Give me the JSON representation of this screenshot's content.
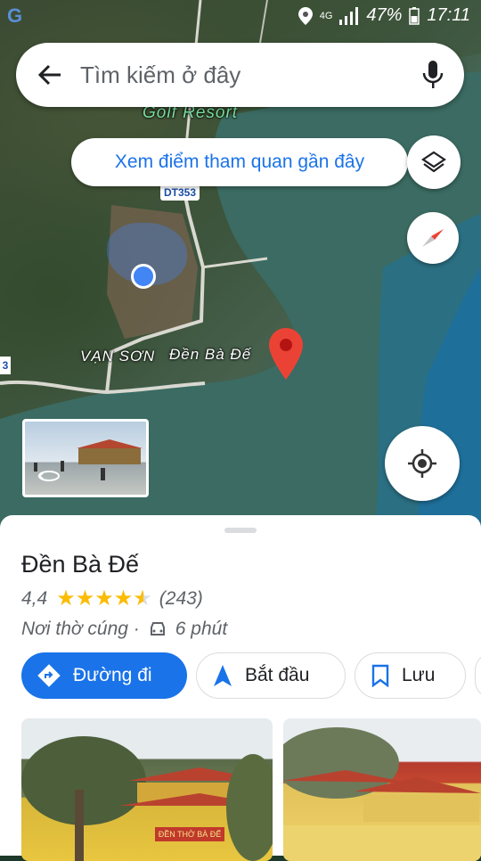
{
  "statusbar": {
    "network": "4G",
    "battery": "47%",
    "time": "17:11"
  },
  "search": {
    "placeholder": "Tìm kiếm ở đây"
  },
  "map": {
    "nearby_chip": "Xem điểm tham quan gần đây",
    "road_badge": "DT353",
    "road_badge_left": "3",
    "labels": {
      "golf": "Golf Resort",
      "van_son": "VẠN SƠN",
      "place": "Đền Bà Đế"
    },
    "icons": {
      "layers": "layers-icon",
      "compass": "compass-icon",
      "location": "my-location-icon",
      "pin": "red-pin-icon",
      "streetview": "street-view-360-icon"
    }
  },
  "place": {
    "title": "Đền Bà Đế",
    "rating": "4,4",
    "stars_value": 4.4,
    "reviews": "(243)",
    "category": "Nơi thờ cúng ·",
    "drive_time": "6 phút"
  },
  "actions": {
    "directions": "Đường đi",
    "start": "Bắt đầu",
    "save": "Lưu"
  },
  "photos": {
    "sign_text": "ĐỀN THỜ BÀ ĐẾ"
  },
  "colors": {
    "accent": "#1a73e8",
    "star": "#fbbc04",
    "pin": "#ea4335"
  }
}
